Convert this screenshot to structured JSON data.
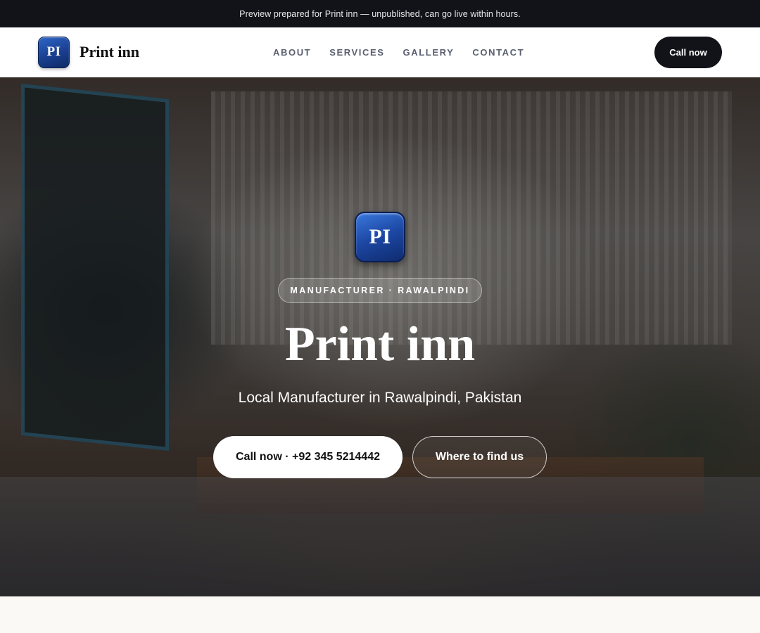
{
  "announcement": {
    "text": "Preview prepared for Print inn — unpublished, can go live within hours."
  },
  "header": {
    "logo_initials": "PI",
    "brand_name": "Print inn",
    "nav": [
      "ABOUT",
      "SERVICES",
      "GALLERY",
      "CONTACT"
    ],
    "call_label": "Call now"
  },
  "hero": {
    "logo_initials": "PI",
    "pill": "MANUFACTURER · RAWALPINDI",
    "title": "Print inn",
    "subtitle": "Local Manufacturer in Rawalpindi, Pakistan",
    "primary_cta": "Call now · +92 345 5214442",
    "secondary_cta": "Where to find us"
  },
  "colors": {
    "topbar": "#111318",
    "accent_blue": "#1c47a3",
    "nav_text": "#5a6070"
  }
}
